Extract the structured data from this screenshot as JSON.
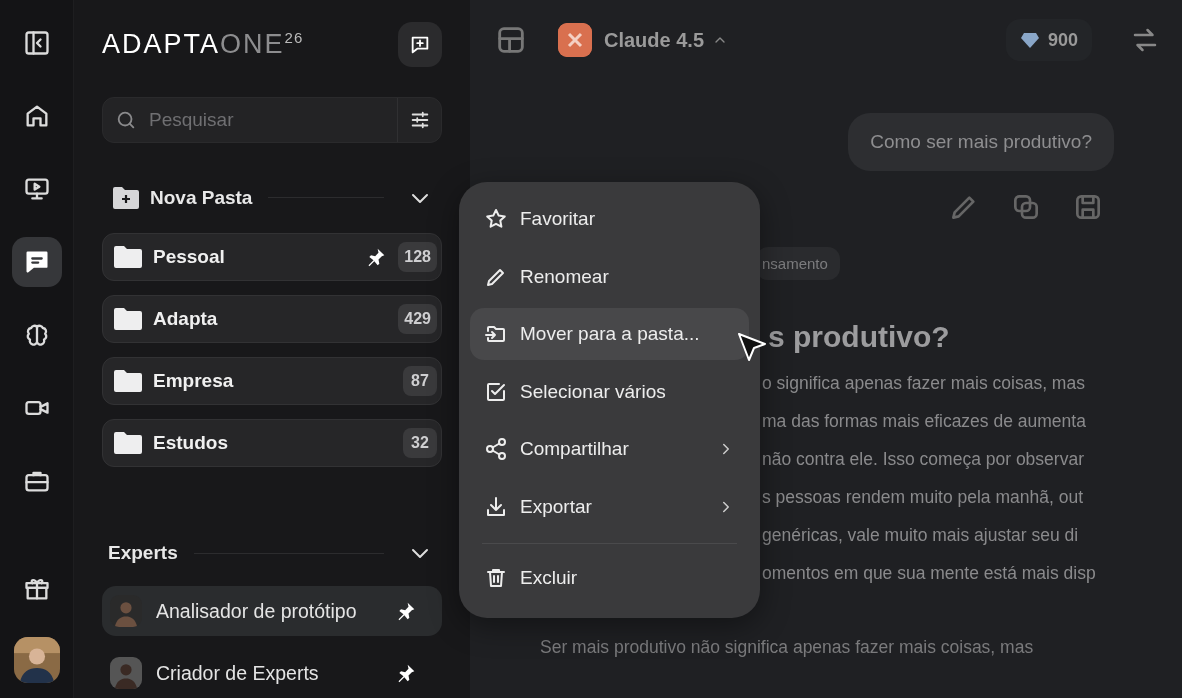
{
  "rail": {
    "items": [
      {
        "selected": false
      },
      {
        "selected": false
      },
      {
        "selected": false
      },
      {
        "selected": true
      },
      {
        "selected": false
      },
      {
        "selected": false
      },
      {
        "selected": false
      },
      {
        "selected": false
      }
    ]
  },
  "sidebar": {
    "logo": {
      "brand": "ADAPTA",
      "product": "ONE",
      "edition": "26"
    },
    "search": {
      "placeholder": "Pesquisar"
    },
    "folders_header": {
      "label": "Nova Pasta",
      "expanded": true
    },
    "folders": [
      {
        "name": "Pessoal",
        "count": "128",
        "pinned": true
      },
      {
        "name": "Adapta",
        "count": "429",
        "pinned": false
      },
      {
        "name": "Empresa",
        "count": "87",
        "pinned": false
      },
      {
        "name": "Estudos",
        "count": "32",
        "pinned": false
      }
    ],
    "experts_header": {
      "label": "Experts",
      "expanded": true
    },
    "experts": [
      {
        "name": "Analisador de protótipo",
        "pinned": true,
        "selected": true
      },
      {
        "name": "Criador de Experts",
        "pinned": true,
        "selected": false
      }
    ]
  },
  "chat": {
    "model": "Claude 4.5",
    "credits": "900",
    "user_message": "Como ser mais produtivo?",
    "tag": "nsamento",
    "heading": "s produtivo?",
    "paragraph_lines": [
      "o significa apenas fazer mais coisas, mas",
      "ma das formas mais eficazes de aumenta",
      "não contra ele. Isso começa por observar",
      "s pessoas rendem muito pela manhã, out",
      "genéricas, vale muito mais ajustar seu di",
      "omentos em que sua mente está mais disp"
    ],
    "next_paragraph": "Ser mais produtivo não significa apenas fazer mais coisas, mas"
  },
  "context_menu": {
    "groups": [
      {
        "items": [
          {
            "label": "Favoritar",
            "selected": false,
            "submenu": false
          },
          {
            "label": "Renomear",
            "selected": false,
            "submenu": false
          },
          {
            "label": "Mover para a pasta...",
            "selected": true,
            "submenu": false
          },
          {
            "label": "Selecionar vários",
            "selected": false,
            "submenu": false
          },
          {
            "label": "Compartilhar",
            "selected": false,
            "submenu": true
          },
          {
            "label": "Exportar",
            "selected": false,
            "submenu": true
          }
        ]
      },
      {
        "items": [
          {
            "label": "Excluir",
            "selected": false,
            "submenu": false
          }
        ]
      }
    ]
  }
}
